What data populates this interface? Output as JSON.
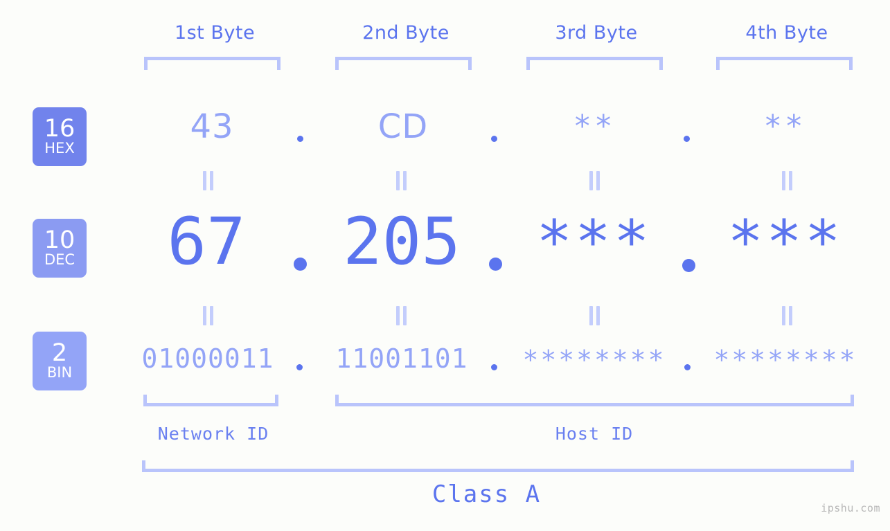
{
  "meta": {
    "background_color": "#fcfdfa",
    "accent_strong": "#5b74ee",
    "accent_mid": "#93a4f7",
    "accent_light": "#b9c4fb",
    "badge_hex_color": "#7183ec",
    "badge_dec_color": "#8b9bf2",
    "badge_bin_color": "#93a4f7",
    "watermark": "ipshu.com"
  },
  "headers": [
    {
      "label": "1st Byte"
    },
    {
      "label": "2nd Byte"
    },
    {
      "label": "3rd Byte"
    },
    {
      "label": "4th Byte"
    }
  ],
  "badges": [
    {
      "base": "16",
      "name": "HEX"
    },
    {
      "base": "10",
      "name": "DEC"
    },
    {
      "base": "2",
      "name": "BIN"
    }
  ],
  "rows": {
    "hex": {
      "base": "16",
      "name": "HEX",
      "values": [
        "43",
        "CD",
        "**",
        "**"
      ]
    },
    "dec": {
      "base": "10",
      "name": "DEC",
      "values": [
        "67",
        "205",
        "***",
        "***"
      ]
    },
    "bin": {
      "base": "2",
      "name": "BIN",
      "values": [
        "01000011",
        "11001101",
        "********",
        "********"
      ]
    }
  },
  "separators": {
    "dot": ".",
    "equals": "||"
  },
  "segments": [
    {
      "label": "Network ID"
    },
    {
      "label": "Host ID"
    }
  ],
  "class": {
    "label": "Class A"
  }
}
